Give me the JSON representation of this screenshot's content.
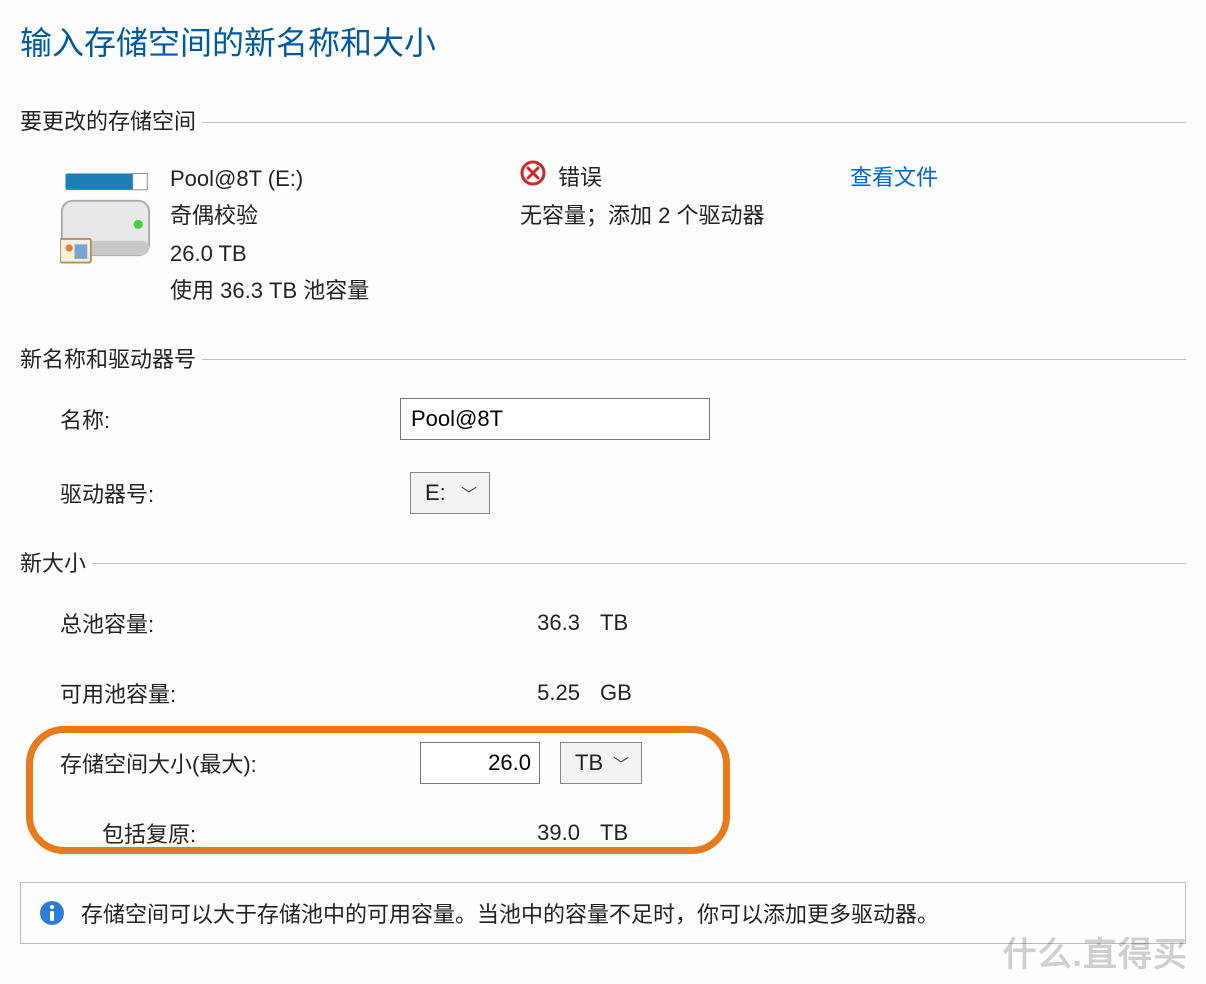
{
  "title": "输入存储空间的新名称和大小",
  "section1": {
    "header": "要更改的存储空间",
    "drive": {
      "name": "Pool@8T (E:)",
      "type": "奇偶校验",
      "size": "26.0 TB",
      "usage": "使用 36.3 TB 池容量"
    },
    "status": {
      "label": "错误",
      "detail": "无容量；添加 2 个驱动器"
    },
    "link": "查看文件"
  },
  "section2": {
    "header": "新名称和驱动器号",
    "name_label": "名称:",
    "name_value": "Pool@8T",
    "drive_letter_label": "驱动器号:",
    "drive_letter_value": "E:"
  },
  "section3": {
    "header": "新大小",
    "total": {
      "label": "总池容量:",
      "value": "36.3",
      "unit": "TB"
    },
    "avail": {
      "label": "可用池容量:",
      "value": "5.25",
      "unit": "GB"
    },
    "max": {
      "label": "存储空间大小(最大):",
      "value": "26.0",
      "unit": "TB"
    },
    "incl": {
      "label": "包括复原:",
      "value": "39.0",
      "unit": "TB"
    }
  },
  "info_text": "存储空间可以大于存储池中的可用容量。当池中的容量不足时，你可以添加更多驱动器。",
  "watermark": "什么.直得买"
}
